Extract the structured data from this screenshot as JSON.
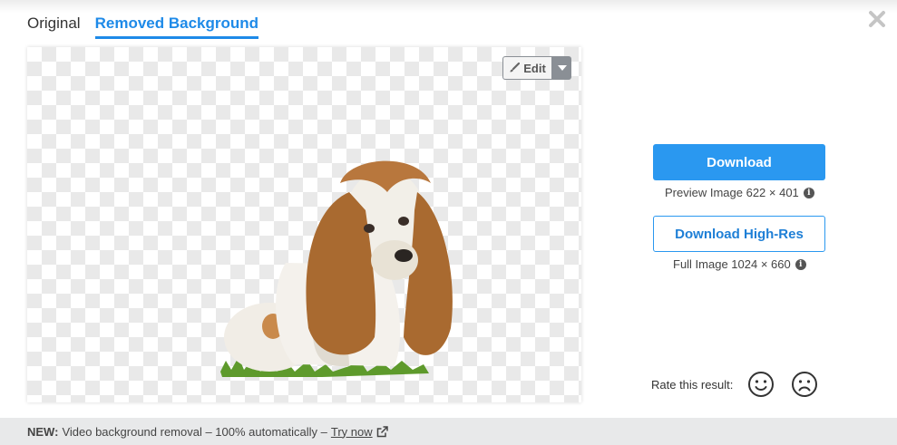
{
  "tabs": [
    {
      "label": "Original",
      "active": false
    },
    {
      "label": "Removed Background",
      "active": true
    }
  ],
  "editor": {
    "edit_label": "Edit"
  },
  "download": {
    "button_label": "Download",
    "preview_info": "Preview Image 622 × 401",
    "hires_label": "Download High-Res",
    "full_info": "Full Image 1024 × 660"
  },
  "rating": {
    "label": "Rate this result:"
  },
  "footer": {
    "prefix": "NEW:",
    "text": "Video background removal – 100% automatically –",
    "link": "Try now"
  },
  "colors": {
    "accent": "#2a98f0",
    "checker": "#e9e9e9",
    "footer_bg": "#e8e9ea"
  },
  "icons": [
    "close-icon",
    "brush-icon",
    "caret-down-icon",
    "info-icon",
    "smile-icon",
    "frown-icon",
    "external-link-icon"
  ]
}
